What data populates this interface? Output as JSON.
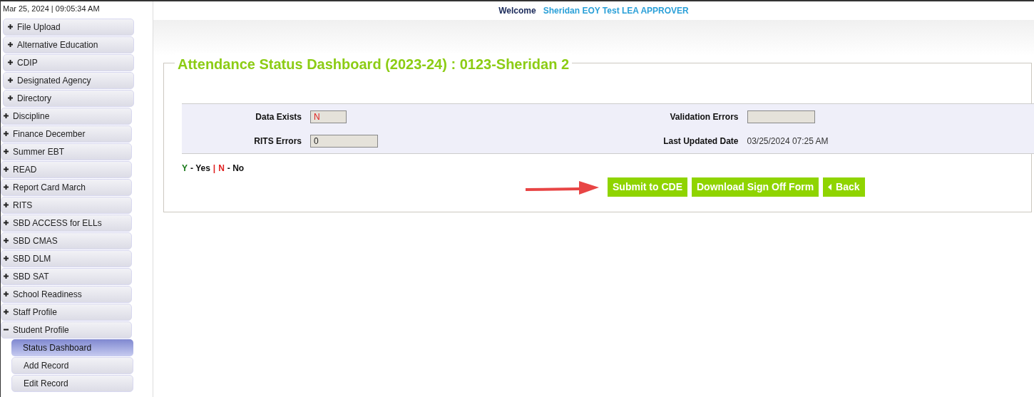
{
  "sidebar": {
    "datetime": "Mar 25, 2024 | 09:05:34 AM",
    "items": [
      {
        "label": "File Upload",
        "expanded": false
      },
      {
        "label": "Alternative Education",
        "expanded": false
      },
      {
        "label": "CDIP",
        "expanded": false
      },
      {
        "label": "Designated Agency",
        "expanded": false
      },
      {
        "label": "Directory",
        "expanded": false
      },
      {
        "label": "Discipline",
        "expanded": false
      },
      {
        "label": "Finance December",
        "expanded": false
      },
      {
        "label": "Summer EBT",
        "expanded": false
      },
      {
        "label": "READ",
        "expanded": false
      },
      {
        "label": "Report Card March",
        "expanded": false
      },
      {
        "label": "RITS",
        "expanded": false
      },
      {
        "label": "SBD ACCESS for ELLs",
        "expanded": false
      },
      {
        "label": "SBD CMAS",
        "expanded": false
      },
      {
        "label": "SBD DLM",
        "expanded": false
      },
      {
        "label": "SBD SAT",
        "expanded": false
      },
      {
        "label": "School Readiness",
        "expanded": false
      },
      {
        "label": "Staff Profile",
        "expanded": false
      },
      {
        "label": "Student Profile",
        "expanded": true,
        "children": [
          {
            "label": "Status Dashboard",
            "selected": true
          },
          {
            "label": "Add Record",
            "selected": false
          },
          {
            "label": "Edit Record",
            "selected": false
          }
        ]
      }
    ]
  },
  "header": {
    "welcome": "Welcome",
    "user": "Sheridan EOY Test LEA APPROVER"
  },
  "dashboard": {
    "title": "Attendance Status Dashboard (2023-24) : 0123-Sheridan 2",
    "fields": [
      {
        "label": "Data Exists",
        "value": "N",
        "kind": "field"
      },
      {
        "label": "Validation Errors",
        "kind": "field"
      },
      {
        "label": "RITS Errors",
        "value": "0",
        "kind": "field"
      },
      {
        "label": "Last Updated Date",
        "value": "03/25/2024 07:25 AM",
        "kind": "text"
      }
    ],
    "legend": [
      {
        "letter": "Y",
        "meaning": " - Yes",
        "color": "#1a7a1a"
      },
      {
        "letter": "N",
        "meaning": " - No",
        "color": "#e02020"
      }
    ],
    "legend_separator": "|",
    "buttons": [
      {
        "label": "Submit to CDE",
        "kind": "plain"
      },
      {
        "label": "Download Sign Off Form",
        "kind": "plain"
      },
      {
        "label": "Back",
        "kind": "back"
      }
    ]
  }
}
